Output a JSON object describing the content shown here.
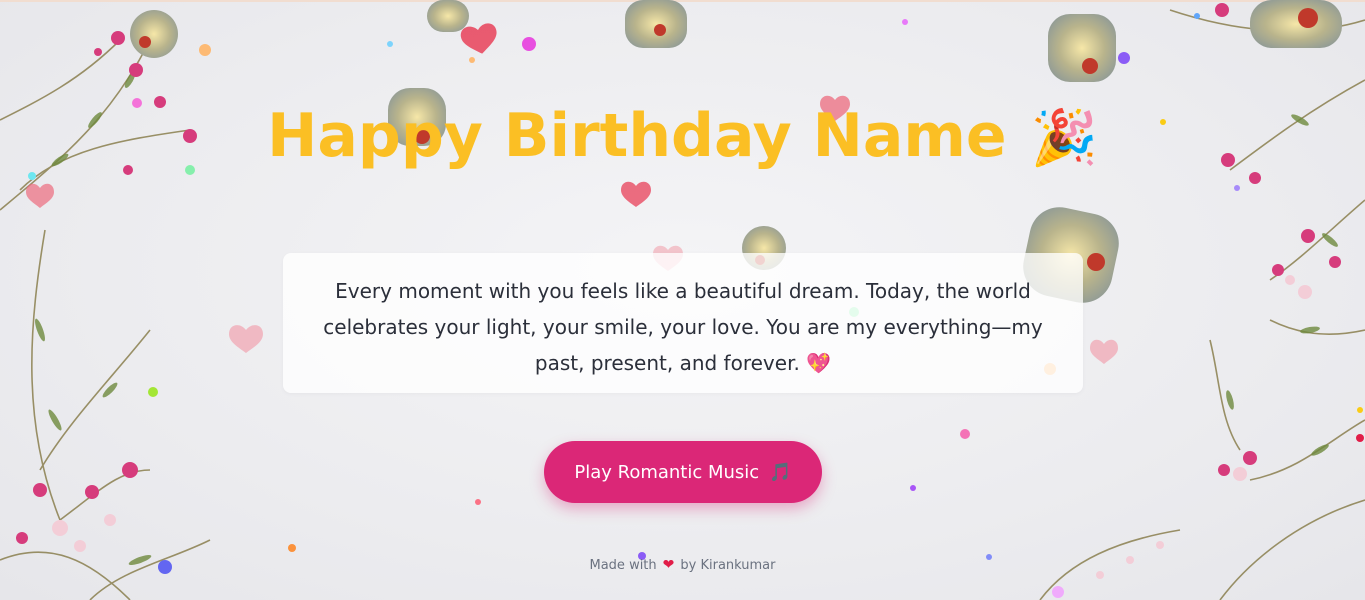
{
  "page": {
    "title": "Happy Birthday Name",
    "title_emoji": "🎉",
    "message": "Every moment with you feels like a beautiful dream. Today, the world celebrates your light, your smile, your love. You are my everything—my past, present, and forever.",
    "message_emoji": "💖",
    "button_label": "Play Romantic Music",
    "button_emoji": "🎵",
    "footer_before": "Made with",
    "footer_heart": "❤",
    "footer_after": "by Kirankumar"
  },
  "colors": {
    "title": "#fbbf24",
    "button": "#db2777",
    "text": "#2b2f3a",
    "footer": "#6b7280"
  },
  "icons": {
    "title": "party-popper-icon",
    "message": "sparkling-heart-icon",
    "button": "music-note-icon",
    "footer": "red-heart-icon"
  }
}
